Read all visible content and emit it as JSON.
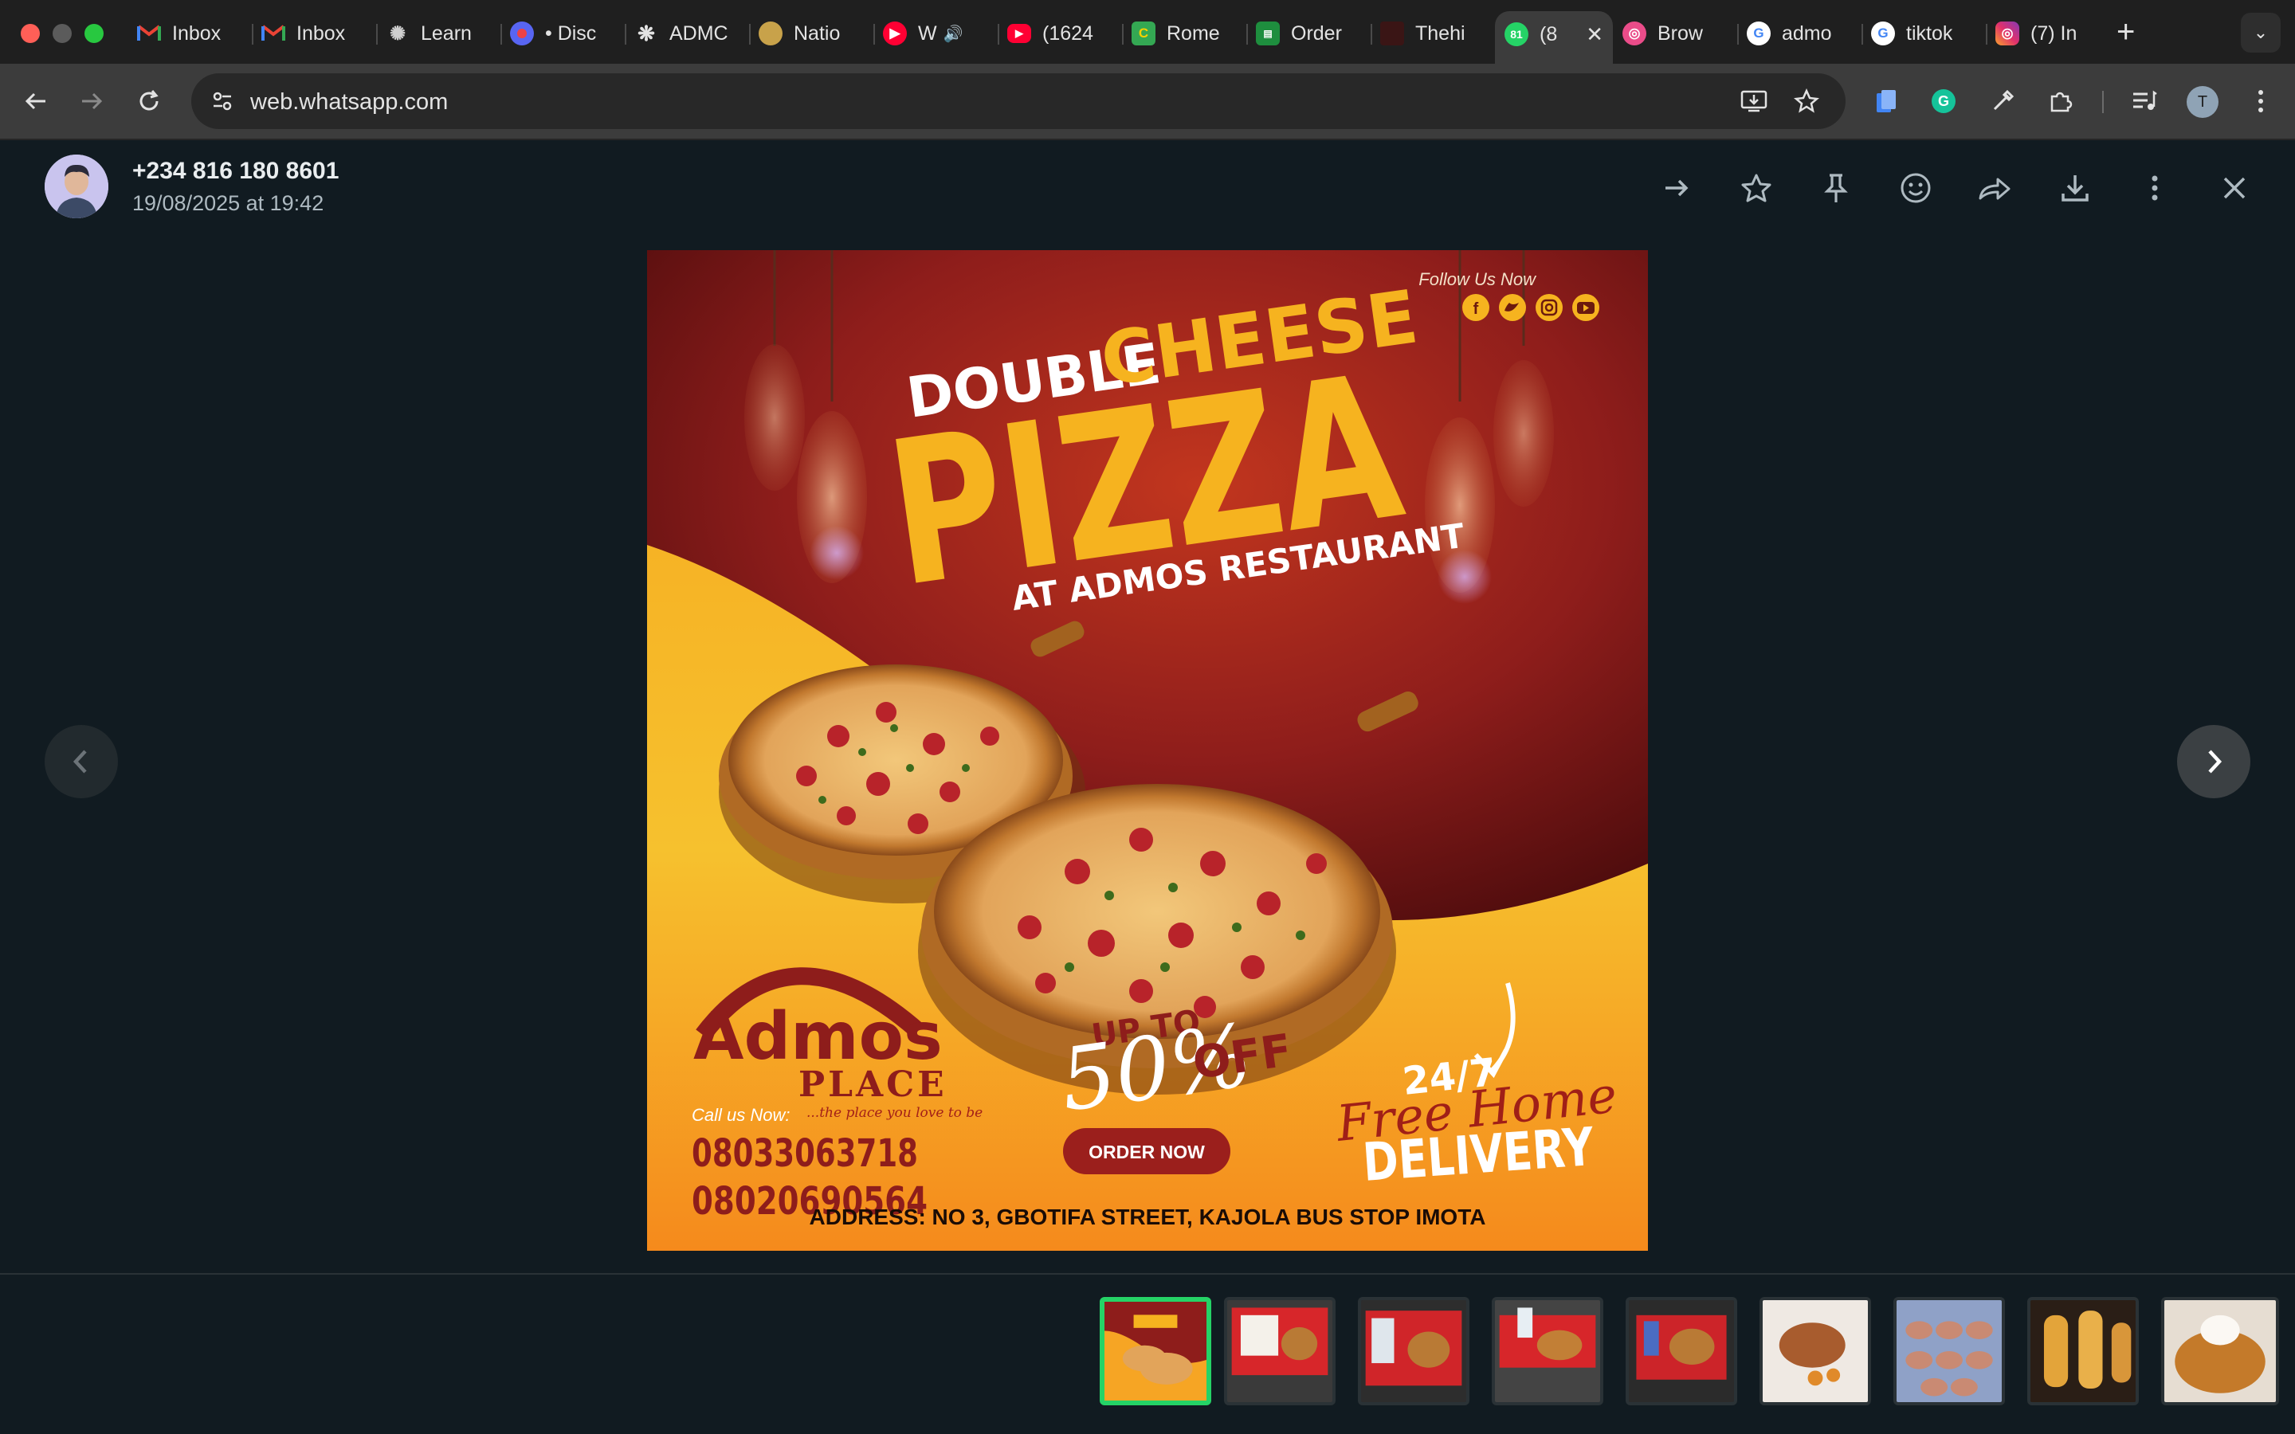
{
  "browser": {
    "tabs": [
      {
        "title": "Inbox",
        "icon": "gmail-icon",
        "color": "#ea4335"
      },
      {
        "title": "Inbox",
        "icon": "gmail-icon",
        "color": "#ea4335"
      },
      {
        "title": "Learn",
        "icon": "learn-icon",
        "color": "#9aa0a6"
      },
      {
        "title": "• Disc",
        "icon": "discord-icon",
        "color": "#5865f2"
      },
      {
        "title": "ADMC",
        "icon": "openai-icon",
        "color": "#e3e3e3"
      },
      {
        "title": "Natio",
        "icon": "national-icon",
        "color": "#c8a24a"
      },
      {
        "title": "W",
        "icon": "youtube-music-icon",
        "color": "#ff0033"
      },
      {
        "title": "(1624",
        "icon": "youtube-icon",
        "color": "#ff0033"
      },
      {
        "title": "Rome",
        "icon": "rome-icon",
        "color": "#34a853"
      },
      {
        "title": "Order",
        "icon": "order-icon",
        "color": "#1e8e3e"
      },
      {
        "title": "Thehi",
        "icon": "thehi-icon",
        "color": "#6b1a1a"
      },
      {
        "title": "(8",
        "icon": "whatsapp-icon",
        "color": "#25d366",
        "badge": "81"
      },
      {
        "title": "Brow",
        "icon": "dribbble-icon",
        "color": "#ea4c89"
      },
      {
        "title": "admo",
        "icon": "google-icon",
        "color": "#4285f4"
      },
      {
        "title": "tiktok",
        "icon": "google-icon",
        "color": "#4285f4"
      },
      {
        "title": "(7) In",
        "icon": "instagram-icon",
        "color": "#e1306c"
      }
    ],
    "url": "web.whatsapp.com",
    "profile_initial": "T"
  },
  "viewer": {
    "contact_name": "+234 816 180 8601",
    "timestamp": "19/08/2025 at 19:42",
    "actions": [
      "forward-arrow-icon",
      "star-icon",
      "pin-icon",
      "emoji-icon",
      "share-icon",
      "download-icon",
      "more-icon",
      "close-icon"
    ],
    "thumbnails": [
      {
        "kind": "pizza-flyer",
        "selected": true
      },
      {
        "kind": "food-tray"
      },
      {
        "kind": "food-tray"
      },
      {
        "kind": "food-tray"
      },
      {
        "kind": "food-tray"
      },
      {
        "kind": "sausage-plate"
      },
      {
        "kind": "pastry-tray"
      },
      {
        "kind": "bread-plate"
      },
      {
        "kind": "rice-plate"
      }
    ]
  },
  "flyer": {
    "follow": "Follow Us Now",
    "title_line1": "DOUBLE",
    "title_line2": "CHEESE",
    "title_main": "PIZZA",
    "subtitle": "AT ADMOS RESTAURANT",
    "brand": "Admos",
    "brand_sub": "PLACE",
    "tagline": "...the place you love to be",
    "call_label": "Call us Now:",
    "phone1": "08033063718",
    "phone2": "08020690564",
    "promo_up": "UP TO",
    "promo_pct": "50%",
    "promo_off": "OFF",
    "order_btn": "ORDER NOW",
    "delivery_hours": "24/7",
    "delivery_script": "Free Home",
    "delivery_word": "DELIVERY",
    "address": "ADDRESS: NO 3, GBOTIFA STREET, KAJOLA BUS STOP IMOTA"
  },
  "colors": {
    "accent": "#25d366",
    "flyer_red": "#8e1d1b",
    "flyer_orange": "#f7a51c",
    "flyer_yellow": "#f6c12e",
    "viewer_bg": "#111b21"
  }
}
